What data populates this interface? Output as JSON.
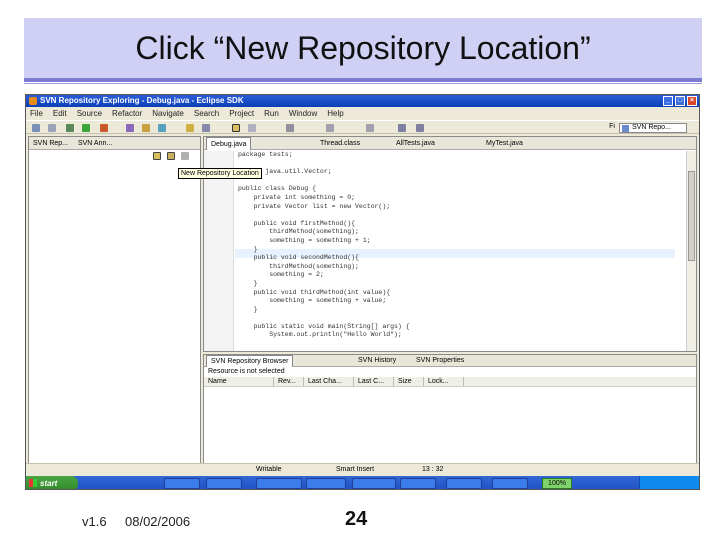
{
  "slide": {
    "title": "Click “New Repository Location”",
    "version": "v1.6",
    "date": "08/02/2006",
    "page_number": "24",
    "band_color": "#cfd0f4",
    "rule_color": "#7b7bd1"
  },
  "window": {
    "title": "SVN Repository Exploring - Debug.java - Eclipse SDK"
  },
  "menu": [
    "File",
    "Edit",
    "Source",
    "Refactor",
    "Navigate",
    "Search",
    "Project",
    "Run",
    "Window",
    "Help"
  ],
  "toolbar": {
    "perspective_label": "SVN Repo...",
    "fi_label": "Fi"
  },
  "left_pane": {
    "tabs": [
      "SVN Rep...",
      "SVN Ann..."
    ],
    "tooltip": "New Repository Location"
  },
  "editor": {
    "tabs": [
      "Debug.java",
      "Thread.class",
      "AllTests.java",
      "MyTest.java"
    ],
    "code_lines": [
      "package tests;",
      "",
      "import java.util.Vector;",
      "",
      "public class Debug {",
      "    private int something = 0;",
      "    private Vector list = new Vector();",
      "",
      "    public void firstMethod(){",
      "        thirdMethod(something);",
      "        something = something + 1;",
      "    }",
      "    public void secondMethod(){",
      "        thirdMethod(something);",
      "        something = 2;",
      "    }",
      "    public void thirdMethod(int value){",
      "        something = something + value;",
      "    }",
      "",
      "    public static void main(String[] args) {",
      "        System.out.println(\"Hello World\");"
    ]
  },
  "bottom_pane": {
    "tabs": [
      "SVN Repository Browser",
      "SVN History",
      "SVN Properties"
    ],
    "resource_text": "Resource is not selected",
    "columns": [
      "Name",
      "Rev...",
      "Last Cha...",
      "Last C...",
      "Size",
      "Lock..."
    ]
  },
  "status": {
    "writable": "Writable",
    "insert_mode": "Smart Insert",
    "position": "13 : 32"
  },
  "taskbar": {
    "start_label": "start",
    "battery": "100%"
  }
}
